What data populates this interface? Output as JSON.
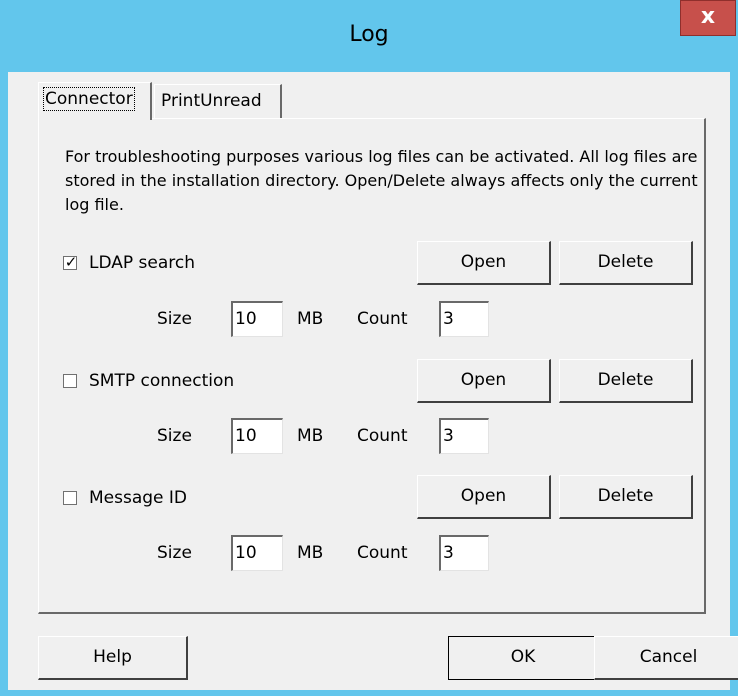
{
  "window": {
    "title": "Log",
    "close_glyph": "x"
  },
  "tabs": [
    {
      "label": "Connector",
      "active": true
    },
    {
      "label": "PrintUnread",
      "active": false
    }
  ],
  "description": "For troubleshooting purposes various log files can be activated. All log files are stored in the installation directory. Open/Delete always affects only the current log file.",
  "logs": [
    {
      "label": "LDAP search",
      "checked": true,
      "size": "10",
      "count": "3"
    },
    {
      "label": "SMTP connection",
      "checked": false,
      "size": "10",
      "count": "3"
    },
    {
      "label": "Message ID",
      "checked": false,
      "size": "10",
      "count": "3"
    }
  ],
  "labels": {
    "open": "Open",
    "delete": "Delete",
    "size": "Size",
    "mb": "MB",
    "count": "Count"
  },
  "buttons": {
    "help": "Help",
    "ok": "OK",
    "cancel": "Cancel"
  },
  "colors": {
    "titlebar": "#62c6ec",
    "close": "#c7504b",
    "face": "#f0f0f0"
  }
}
